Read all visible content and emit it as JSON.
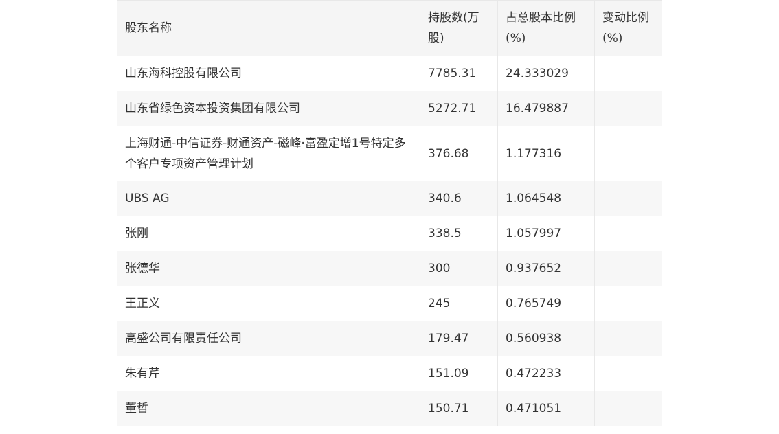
{
  "table": {
    "headers": [
      "股东名称",
      "持股数(万股)",
      "占总股本比例(%)",
      "变动比例(%)"
    ],
    "rows": [
      {
        "name": "山东海科控股有限公司",
        "shares": "7785.31",
        "ratio": "24.333029",
        "change": ""
      },
      {
        "name": "山东省绿色资本投资集团有限公司",
        "shares": "5272.71",
        "ratio": "16.479887",
        "change": ""
      },
      {
        "name": "上海财通-中信证券-财通资产-磁峰·富盈定增1号特定多个客户专项资产管理计划",
        "shares": "376.68",
        "ratio": "1.177316",
        "change": ""
      },
      {
        "name": "UBS AG",
        "shares": "340.6",
        "ratio": "1.064548",
        "change": ""
      },
      {
        "name": "张刚",
        "shares": "338.5",
        "ratio": "1.057997",
        "change": ""
      },
      {
        "name": "张德华",
        "shares": "300",
        "ratio": "0.937652",
        "change": ""
      },
      {
        "name": "王正义",
        "shares": "245",
        "ratio": "0.765749",
        "change": ""
      },
      {
        "name": "高盛公司有限责任公司",
        "shares": "179.47",
        "ratio": "0.560938",
        "change": ""
      },
      {
        "name": "朱有芹",
        "shares": "151.09",
        "ratio": "0.472233",
        "change": ""
      },
      {
        "name": "董哲",
        "shares": "150.71",
        "ratio": "0.471051",
        "change": ""
      }
    ]
  }
}
